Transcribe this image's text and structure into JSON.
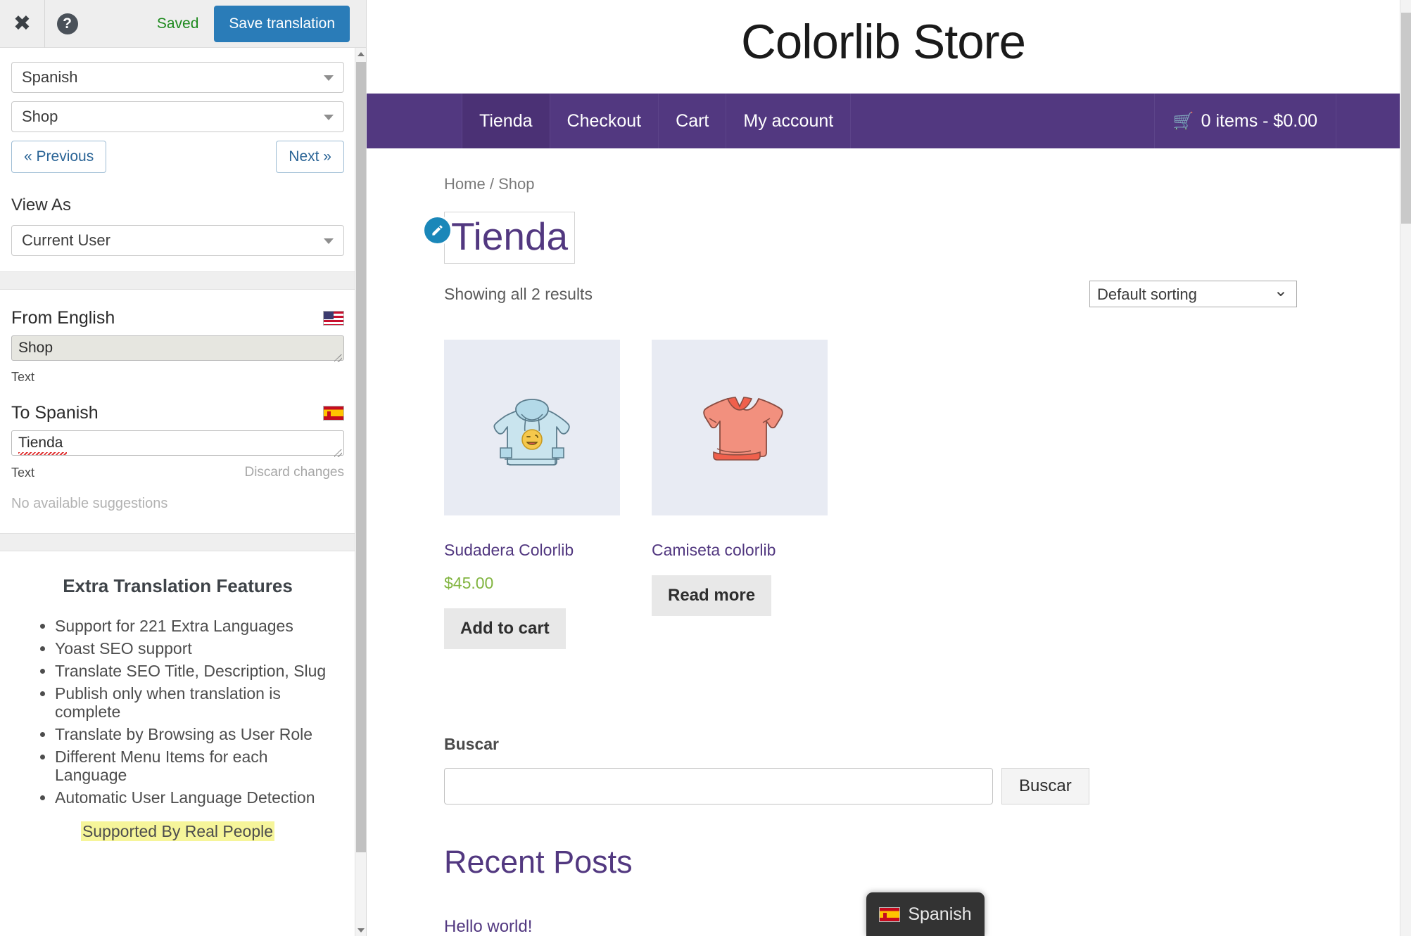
{
  "panel": {
    "header": {
      "close_icon": "close-icon",
      "help_icon": "help-circle-icon",
      "saved_status": "Saved",
      "save_button": "Save translation"
    },
    "language_select": {
      "value": "Spanish"
    },
    "page_select": {
      "value": "Shop"
    },
    "prev_button": "« Previous",
    "next_button": "Next »",
    "view_as_label": "View As",
    "view_as_select": {
      "value": "Current User"
    },
    "source": {
      "heading": "From English",
      "flag": "us-flag-icon",
      "value": "Shop",
      "meta_label": "Text"
    },
    "target": {
      "heading": "To Spanish",
      "flag": "es-flag-icon",
      "value": "Tienda",
      "meta_label": "Text",
      "discard_label": "Discard changes",
      "suggestions": "No available suggestions"
    },
    "extra": {
      "title": "Extra Translation Features",
      "features": [
        "Support for 221 Extra Languages",
        "Yoast SEO support",
        "Translate SEO Title, Description, Slug",
        "Publish only when translation is complete",
        "Translate by Browsing as User Role",
        "Different Menu Items for each Language",
        "Automatic User Language Detection"
      ],
      "supported_by": "Supported By Real People"
    }
  },
  "site": {
    "title": "Colorlib Store",
    "nav": [
      {
        "label": "Tienda",
        "active": true
      },
      {
        "label": "Checkout",
        "active": false
      },
      {
        "label": "Cart",
        "active": false
      },
      {
        "label": "My account",
        "active": false
      }
    ],
    "cart": {
      "icon": "shopping-cart-icon",
      "text": "0 items - $0.00"
    },
    "breadcrumb": {
      "home": "Home",
      "sep": "/",
      "current": "Shop"
    },
    "page_heading": "Tienda",
    "edit_icon": "pencil-icon",
    "results_text": "Showing all 2 results",
    "sorting": {
      "value": "Default sorting"
    },
    "products": [
      {
        "name": "Sudadera Colorlib",
        "price": "$45.00",
        "button": "Add to cart",
        "image": "hoodie-illustration"
      },
      {
        "name": "Camiseta colorlib",
        "price": "",
        "button": "Read more",
        "image": "tshirt-illustration"
      }
    ],
    "search": {
      "label": "Buscar",
      "value": "",
      "placeholder": "",
      "button": "Buscar"
    },
    "recent_posts_heading": "Recent Posts",
    "recent_posts": [
      "Hello world!"
    ],
    "language_badge": {
      "flag": "es-flag-icon",
      "label": "Spanish"
    }
  },
  "colors": {
    "brand_purple": "#523880",
    "nav_active": "#4b3175",
    "save_blue": "#2a7cb8",
    "saved_green": "#1e8a1e",
    "price_green": "#82b541",
    "pencil_blue": "#1a87b9",
    "highlight_yellow": "#f6f59a"
  }
}
